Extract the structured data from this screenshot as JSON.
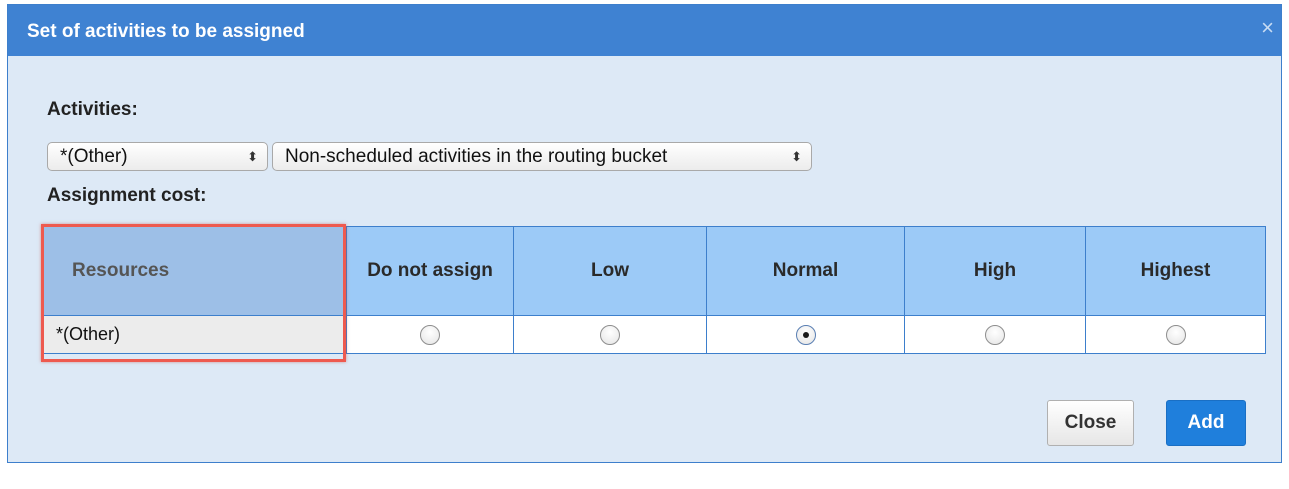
{
  "dialog": {
    "title": "Set of activities to be assigned",
    "close_icon": "×"
  },
  "activities": {
    "label": "Activities:",
    "type_select": {
      "value": "*(Other)"
    },
    "scope_select": {
      "value": "Non-scheduled activities in the routing bucket"
    },
    "select_arrows": "⬍"
  },
  "assignment_cost": {
    "label": "Assignment cost:",
    "columns": [
      "Resources",
      "Do not assign",
      "Low",
      "Normal",
      "High",
      "Highest"
    ],
    "rows": [
      {
        "resource": "*(Other)",
        "selected": "Normal"
      }
    ]
  },
  "buttons": {
    "close_label": "Close",
    "add_label": "Add"
  },
  "colors": {
    "titlebar": "#3f82d2",
    "dialog_bg": "#dde9f6",
    "header_bg": "#9ccaf7",
    "highlight": "#ee5a4f",
    "primary_button": "#1f7fdc"
  }
}
